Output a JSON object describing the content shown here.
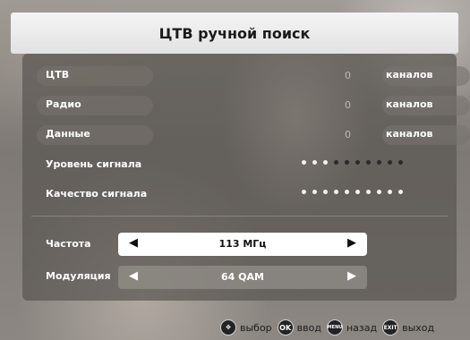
{
  "title": "ЦТВ ручной поиск",
  "rows": [
    {
      "label": "ЦТВ",
      "count": "0",
      "unit": "каналов"
    },
    {
      "label": "Радио",
      "count": "0",
      "unit": "каналов"
    },
    {
      "label": "Данные",
      "count": "0",
      "unit": "каналов"
    }
  ],
  "signal_level": {
    "label": "Уровень сигнала",
    "filled": 3,
    "total": 10
  },
  "signal_quality": {
    "label": "Качество сигнала",
    "filled": 10,
    "total": 10
  },
  "frequency": {
    "label": "Частота",
    "value": "113 МГц"
  },
  "modulation": {
    "label": "Модуляция",
    "value": "64 QAM"
  },
  "footer": [
    {
      "icon": "dpad-icon",
      "badge": "",
      "label": "выбор"
    },
    {
      "icon": "ok-icon",
      "badge": "OK",
      "label": "ввод"
    },
    {
      "icon": "menu-icon",
      "badge": "MENU",
      "label": "назад"
    },
    {
      "icon": "exit-icon",
      "badge": "EXIT",
      "label": "выход"
    }
  ],
  "colors": {
    "dot_on": "#f2f2f2",
    "dot_off": "#2a2a2a",
    "active_selector": "#ffffff"
  }
}
